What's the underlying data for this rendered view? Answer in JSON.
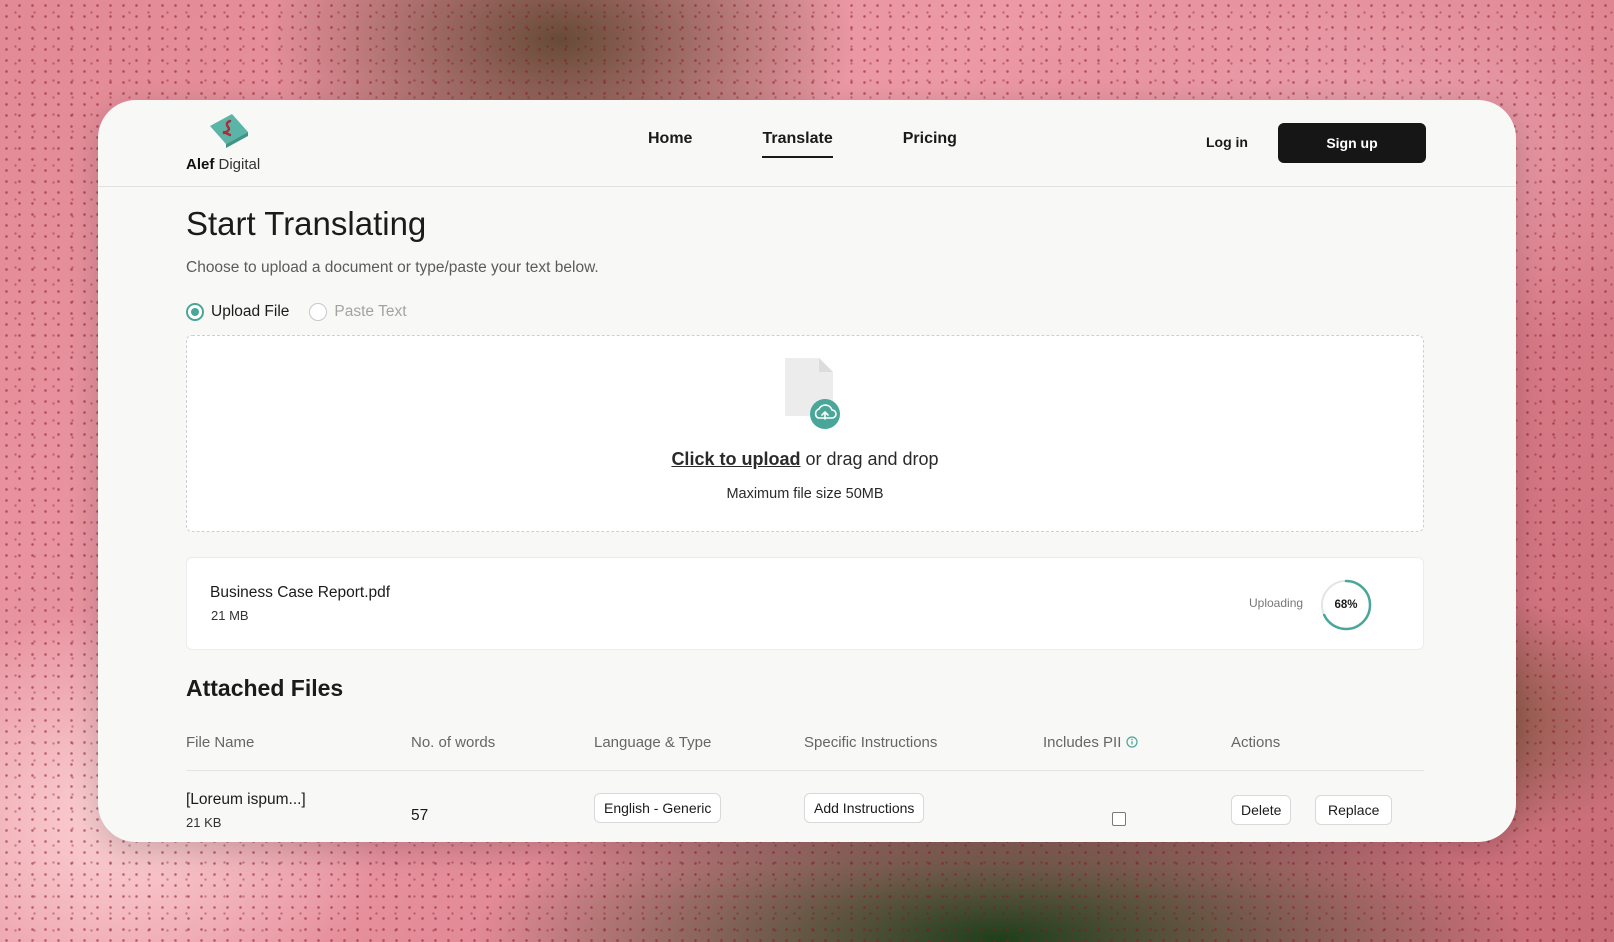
{
  "brand": {
    "name_bold": "Alef",
    "name_light": "Digital"
  },
  "nav": {
    "links": [
      {
        "label": "Home",
        "active": false
      },
      {
        "label": "Translate",
        "active": true
      },
      {
        "label": "Pricing",
        "active": false
      }
    ],
    "login_label": "Log in",
    "signup_label": "Sign up"
  },
  "page": {
    "title": "Start Translating",
    "subtitle": "Choose to upload a document or type/paste your text below."
  },
  "mode": {
    "options": [
      {
        "label": "Upload File",
        "checked": true
      },
      {
        "label": "Paste Text",
        "checked": false
      }
    ]
  },
  "dropzone": {
    "link_text": "Click to upload",
    "rest_text": " or drag and drop",
    "note": "Maximum file size 50MB"
  },
  "upload": {
    "file_name": "Business Case Report.pdf",
    "file_size": "21 MB",
    "status": "Uploading",
    "progress_label": "68%",
    "progress": 0.68
  },
  "attached": {
    "title": "Attached Files",
    "columns": [
      "File Name",
      "No. of words",
      "Language & Type",
      "Specific Instructions",
      "Includes PII",
      "Actions"
    ],
    "rows": [
      {
        "file_name": "[Loreum ispum...]",
        "file_size": "21 KB",
        "words": "57",
        "language": "English - Generic",
        "instructions_label": "Add Instructions",
        "includes_pii": false,
        "delete_label": "Delete",
        "replace_label": "Replace"
      }
    ]
  },
  "colors": {
    "accent": "#4aa699",
    "primary_button": "#161616",
    "logo_diamond": "#5bb5a6",
    "logo_glyph": "#b0283c"
  }
}
